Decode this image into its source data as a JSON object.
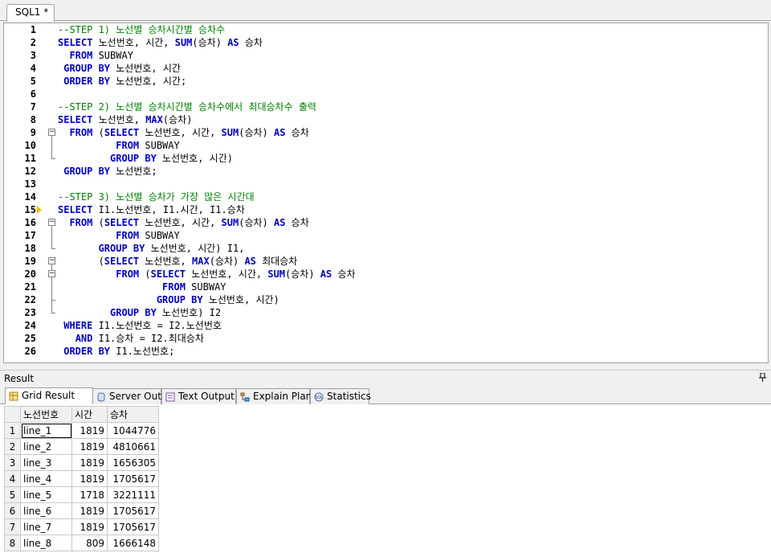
{
  "editor": {
    "tab_label": "SQL1 *",
    "lines": [
      {
        "n": "1",
        "tokens": [
          [
            "cm",
            "--STEP 1) 노선별 승차시간별 승차수"
          ]
        ]
      },
      {
        "n": "2",
        "tokens": [
          [
            "kw",
            "SELECT"
          ],
          [
            "id",
            " 노선번호, 시간, "
          ],
          [
            "kw",
            "SUM"
          ],
          [
            "id",
            "(승차) "
          ],
          [
            "kw",
            "AS"
          ],
          [
            "id",
            " 승차"
          ]
        ]
      },
      {
        "n": "3",
        "tokens": [
          [
            "id",
            "  "
          ],
          [
            "kw",
            "FROM"
          ],
          [
            "id",
            " SUBWAY"
          ]
        ]
      },
      {
        "n": "4",
        "tokens": [
          [
            "id",
            " "
          ],
          [
            "kw",
            "GROUP BY"
          ],
          [
            "id",
            " 노선번호, 시간"
          ]
        ]
      },
      {
        "n": "5",
        "tokens": [
          [
            "id",
            " "
          ],
          [
            "kw",
            "ORDER BY"
          ],
          [
            "id",
            " 노선번호, 시간;"
          ]
        ]
      },
      {
        "n": "6",
        "tokens": []
      },
      {
        "n": "7",
        "tokens": [
          [
            "cm",
            "--STEP 2) 노선별 승차시간별 승차수에서 최대승차수 출력"
          ]
        ]
      },
      {
        "n": "8",
        "tokens": [
          [
            "kw",
            "SELECT"
          ],
          [
            "id",
            " 노선번호, "
          ],
          [
            "kw",
            "MAX"
          ],
          [
            "id",
            "(승차)"
          ]
        ]
      },
      {
        "n": "9",
        "tokens": [
          [
            "id",
            "  "
          ],
          [
            "kw",
            "FROM"
          ],
          [
            "id",
            " ("
          ],
          [
            "kw",
            "SELECT"
          ],
          [
            "id",
            " 노선번호, 시간, "
          ],
          [
            "kw",
            "SUM"
          ],
          [
            "id",
            "(승차) "
          ],
          [
            "kw",
            "AS"
          ],
          [
            "id",
            " 승차"
          ]
        ]
      },
      {
        "n": "10",
        "tokens": [
          [
            "id",
            "          "
          ],
          [
            "kw",
            "FROM"
          ],
          [
            "id",
            " SUBWAY"
          ]
        ]
      },
      {
        "n": "11",
        "tokens": [
          [
            "id",
            "         "
          ],
          [
            "kw",
            "GROUP BY"
          ],
          [
            "id",
            " 노선번호, 시간)"
          ]
        ]
      },
      {
        "n": "12",
        "tokens": [
          [
            "id",
            " "
          ],
          [
            "kw",
            "GROUP BY"
          ],
          [
            "id",
            " 노선번호;"
          ]
        ]
      },
      {
        "n": "13",
        "tokens": []
      },
      {
        "n": "14",
        "tokens": [
          [
            "cm",
            "--STEP 3) 노선별 승차가 가장 많은 시간대"
          ]
        ]
      },
      {
        "n": "15",
        "tokens": [
          [
            "kw",
            "SELECT"
          ],
          [
            "id",
            " I1.노선번호, I1.시간, I1.승차"
          ]
        ]
      },
      {
        "n": "16",
        "tokens": [
          [
            "id",
            "  "
          ],
          [
            "kw",
            "FROM"
          ],
          [
            "id",
            " ("
          ],
          [
            "kw",
            "SELECT"
          ],
          [
            "id",
            " 노선번호, 시간, "
          ],
          [
            "kw",
            "SUM"
          ],
          [
            "id",
            "(승차) "
          ],
          [
            "kw",
            "AS"
          ],
          [
            "id",
            " 승차"
          ]
        ]
      },
      {
        "n": "17",
        "tokens": [
          [
            "id",
            "          "
          ],
          [
            "kw",
            "FROM"
          ],
          [
            "id",
            " SUBWAY"
          ]
        ]
      },
      {
        "n": "18",
        "tokens": [
          [
            "id",
            "       "
          ],
          [
            "kw",
            "GROUP BY"
          ],
          [
            "id",
            " 노선번호, 시간) I1,"
          ]
        ]
      },
      {
        "n": "19",
        "tokens": [
          [
            "id",
            "       ("
          ],
          [
            "kw",
            "SELECT"
          ],
          [
            "id",
            " 노선번호, "
          ],
          [
            "kw",
            "MAX"
          ],
          [
            "id",
            "(승차) "
          ],
          [
            "kw",
            "AS"
          ],
          [
            "id",
            " 최대승차"
          ]
        ]
      },
      {
        "n": "20",
        "tokens": [
          [
            "id",
            "          "
          ],
          [
            "kw",
            "FROM"
          ],
          [
            "id",
            " ("
          ],
          [
            "kw",
            "SELECT"
          ],
          [
            "id",
            " 노선번호, 시간, "
          ],
          [
            "kw",
            "SUM"
          ],
          [
            "id",
            "(승차) "
          ],
          [
            "kw",
            "AS"
          ],
          [
            "id",
            " 승차"
          ]
        ]
      },
      {
        "n": "21",
        "tokens": [
          [
            "id",
            "                  "
          ],
          [
            "kw",
            "FROM"
          ],
          [
            "id",
            " SUBWAY"
          ]
        ]
      },
      {
        "n": "22",
        "tokens": [
          [
            "id",
            "                 "
          ],
          [
            "kw",
            "GROUP BY"
          ],
          [
            "id",
            " 노선번호, 시간)"
          ]
        ]
      },
      {
        "n": "23",
        "tokens": [
          [
            "id",
            "         "
          ],
          [
            "kw",
            "GROUP BY"
          ],
          [
            "id",
            " 노선번호) I2"
          ]
        ]
      },
      {
        "n": "24",
        "tokens": [
          [
            "id",
            " "
          ],
          [
            "kw",
            "WHERE"
          ],
          [
            "id",
            " I1.노선번호 = I2.노선번호"
          ]
        ]
      },
      {
        "n": "25",
        "tokens": [
          [
            "id",
            "   "
          ],
          [
            "kw",
            "AND"
          ],
          [
            "id",
            " I1.승차 = I2.최대승차"
          ]
        ]
      },
      {
        "n": "26",
        "tokens": [
          [
            "id",
            " "
          ],
          [
            "kw",
            "ORDER BY"
          ],
          [
            "id",
            " I1.노선번호;"
          ]
        ]
      }
    ]
  },
  "result": {
    "title": "Result",
    "pin_icon": "pin-icon",
    "tabs": [
      {
        "label": "Grid Result",
        "icon": "grid-icon",
        "active": true
      },
      {
        "label": "Server Output",
        "icon": "server-icon",
        "active": false
      },
      {
        "label": "Text Output",
        "icon": "text-icon",
        "active": false
      },
      {
        "label": "Explain Plan",
        "icon": "plan-icon",
        "active": false
      },
      {
        "label": "Statistics",
        "icon": "sql-stats-icon",
        "active": false
      }
    ],
    "columns": [
      "노선번호",
      "시간",
      "승차"
    ],
    "rows": [
      [
        "1",
        "line_1",
        "1819",
        "1044776"
      ],
      [
        "2",
        "line_2",
        "1819",
        "4810661"
      ],
      [
        "3",
        "line_3",
        "1819",
        "1656305"
      ],
      [
        "4",
        "line_4",
        "1819",
        "1705617"
      ],
      [
        "5",
        "line_5",
        "1718",
        "3221111"
      ],
      [
        "6",
        "line_6",
        "1819",
        "1705617"
      ],
      [
        "7",
        "line_7",
        "1819",
        "1705617"
      ],
      [
        "8",
        "line_8",
        "809",
        "1666148"
      ]
    ]
  },
  "colors": {
    "keyword": "#0000c0",
    "comment": "#008000",
    "current_line_arrow": "#e8c000"
  }
}
